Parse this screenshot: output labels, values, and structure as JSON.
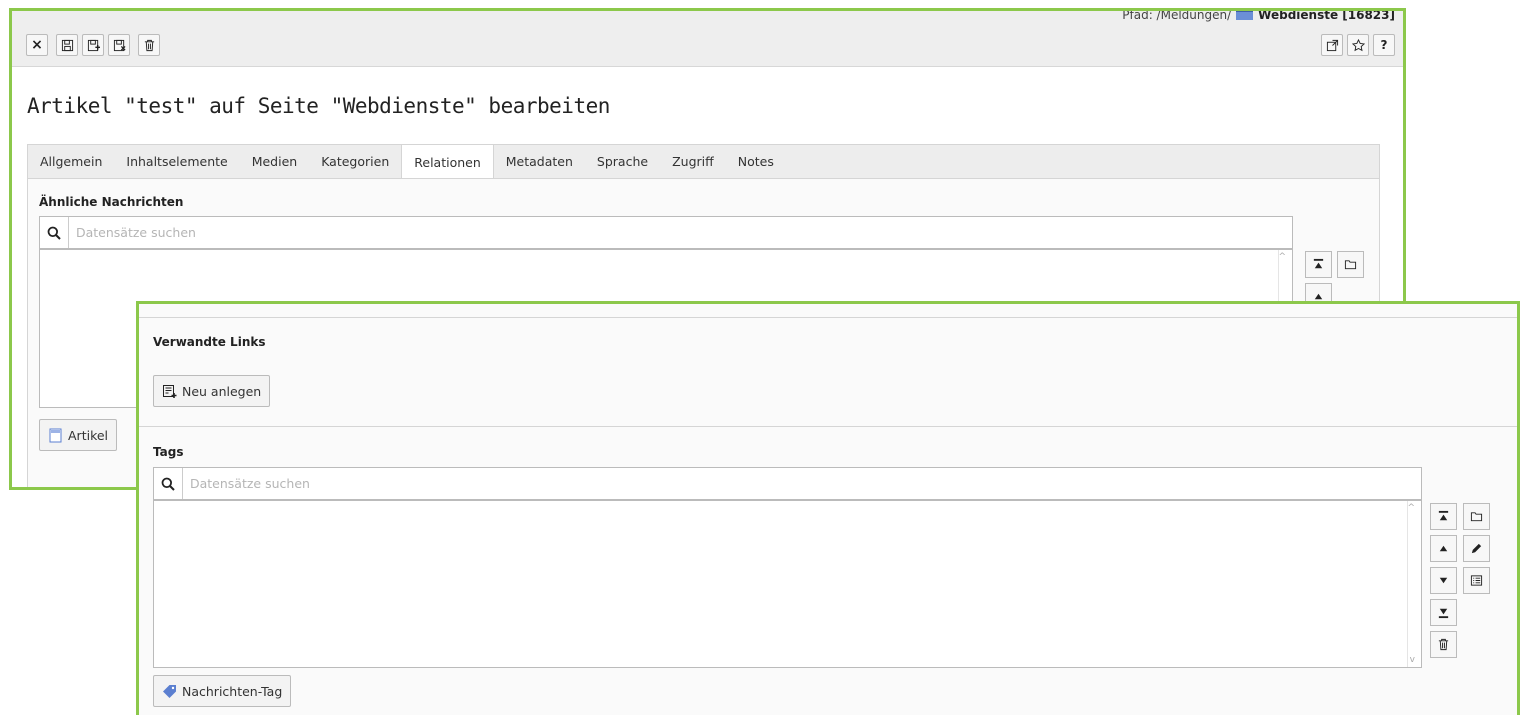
{
  "path": {
    "prefix": "Pfad: /Meldungen/",
    "page": "Webdienste [16823]"
  },
  "toolbar": {
    "close": "×",
    "help": "?"
  },
  "page_title": "Artikel \"test\" auf Seite \"Webdienste\" bearbeiten",
  "tabs": [
    {
      "label": "Allgemein"
    },
    {
      "label": "Inhaltselemente"
    },
    {
      "label": "Medien"
    },
    {
      "label": "Kategorien"
    },
    {
      "label": "Relationen",
      "active": true
    },
    {
      "label": "Metadaten"
    },
    {
      "label": "Sprache"
    },
    {
      "label": "Zugriff"
    },
    {
      "label": "Notes"
    }
  ],
  "related_news": {
    "label": "Ähnliche Nachrichten",
    "search_placeholder": "Datensätze suchen",
    "add_button": "Artikel"
  },
  "related_links": {
    "label": "Verwandte Links",
    "add_button": "Neu anlegen"
  },
  "tags": {
    "label": "Tags",
    "search_placeholder": "Datensätze suchen",
    "add_button": "Nachrichten-Tag"
  },
  "colors": {
    "highlight_border": "#8cc84b",
    "tag_icon": "#5b7fd0"
  }
}
